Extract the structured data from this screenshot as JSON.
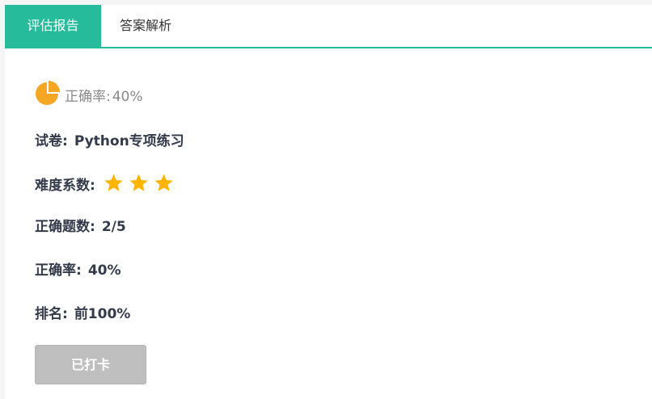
{
  "tabs": [
    {
      "label": "评估报告",
      "active": true
    },
    {
      "label": "答案解析",
      "active": false
    }
  ],
  "accuracy_header": {
    "label": "正确率:",
    "value": "40%",
    "icon": "pie-chart-icon",
    "fraction": 0.25
  },
  "stats": {
    "paper": {
      "label": "试卷:",
      "value": "Python专项练习"
    },
    "difficulty": {
      "label": "难度系数:",
      "stars": 3
    },
    "correct": {
      "label": "正确题数:",
      "value": "2/5"
    },
    "rate": {
      "label": "正确率:",
      "value": "40%"
    },
    "rank": {
      "label": "排名:",
      "value": "前100%"
    }
  },
  "checkin_button": {
    "label": "已打卡"
  },
  "colors": {
    "accent": "#25bb9b",
    "orange": "#f5a623",
    "star": "#ffb400",
    "button_disabled": "#bfbfbf"
  }
}
